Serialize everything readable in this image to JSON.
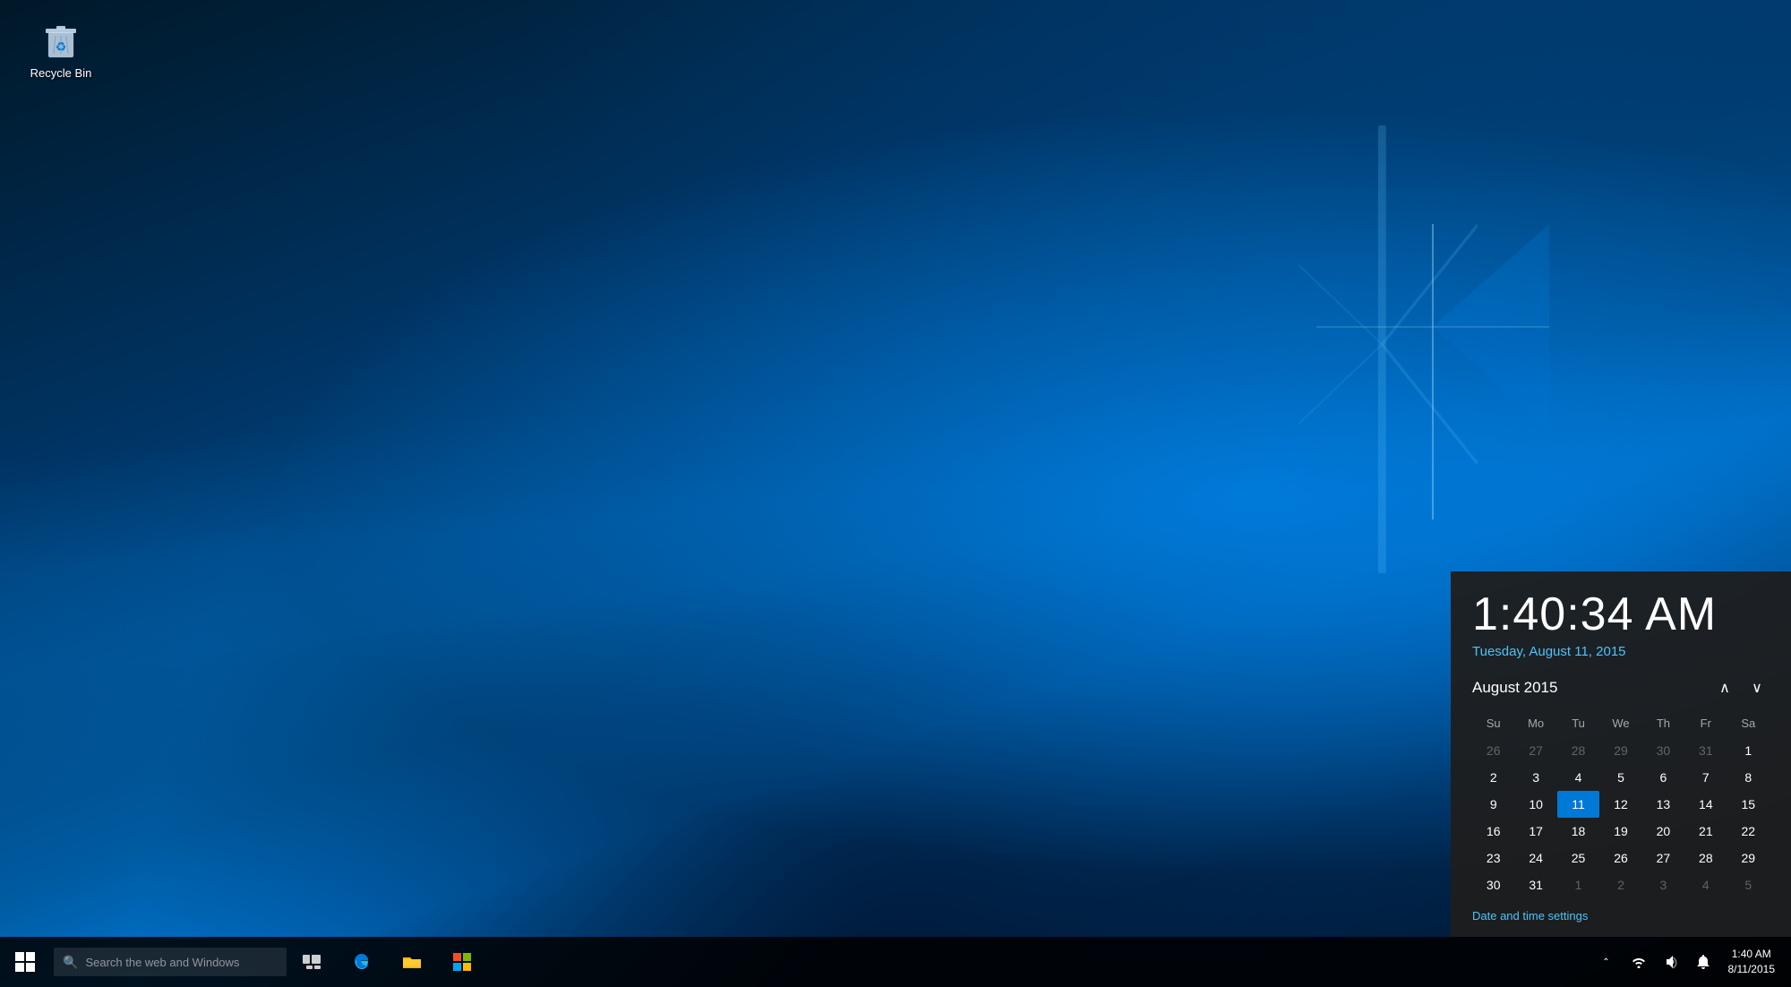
{
  "desktop": {
    "recycle_bin_label": "Recycle Bin"
  },
  "taskbar": {
    "search_placeholder": "Search the web and Windows",
    "clock": {
      "time": "1:40 AM",
      "date": "8/11/2015"
    }
  },
  "calendar_popup": {
    "time": "1:40:34 AM",
    "date_full": "Tuesday, August 11, 2015",
    "month_year": "August 2015",
    "nav_prev": "˄",
    "nav_next": "˅",
    "day_headers": [
      "Su",
      "Mo",
      "Tu",
      "We",
      "Th",
      "Fr",
      "Sa"
    ],
    "weeks": [
      [
        {
          "day": "26",
          "type": "other-month"
        },
        {
          "day": "27",
          "type": "other-month"
        },
        {
          "day": "28",
          "type": "other-month"
        },
        {
          "day": "29",
          "type": "other-month"
        },
        {
          "day": "30",
          "type": "other-month"
        },
        {
          "day": "31",
          "type": "other-month"
        },
        {
          "day": "1",
          "type": "normal"
        }
      ],
      [
        {
          "day": "2",
          "type": "normal"
        },
        {
          "day": "3",
          "type": "normal"
        },
        {
          "day": "4",
          "type": "normal"
        },
        {
          "day": "5",
          "type": "normal"
        },
        {
          "day": "6",
          "type": "normal"
        },
        {
          "day": "7",
          "type": "normal"
        },
        {
          "day": "8",
          "type": "normal"
        }
      ],
      [
        {
          "day": "9",
          "type": "normal"
        },
        {
          "day": "10",
          "type": "normal"
        },
        {
          "day": "11",
          "type": "today"
        },
        {
          "day": "12",
          "type": "normal"
        },
        {
          "day": "13",
          "type": "normal"
        },
        {
          "day": "14",
          "type": "normal"
        },
        {
          "day": "15",
          "type": "normal"
        }
      ],
      [
        {
          "day": "16",
          "type": "normal"
        },
        {
          "day": "17",
          "type": "normal"
        },
        {
          "day": "18",
          "type": "normal"
        },
        {
          "day": "19",
          "type": "normal"
        },
        {
          "day": "20",
          "type": "normal"
        },
        {
          "day": "21",
          "type": "normal"
        },
        {
          "day": "22",
          "type": "normal"
        }
      ],
      [
        {
          "day": "23",
          "type": "normal"
        },
        {
          "day": "24",
          "type": "normal"
        },
        {
          "day": "25",
          "type": "normal"
        },
        {
          "day": "26",
          "type": "normal"
        },
        {
          "day": "27",
          "type": "normal"
        },
        {
          "day": "28",
          "type": "normal"
        },
        {
          "day": "29",
          "type": "normal"
        }
      ],
      [
        {
          "day": "30",
          "type": "normal"
        },
        {
          "day": "31",
          "type": "normal"
        },
        {
          "day": "1",
          "type": "other-month"
        },
        {
          "day": "2",
          "type": "other-month"
        },
        {
          "day": "3",
          "type": "other-month"
        },
        {
          "day": "4",
          "type": "other-month"
        },
        {
          "day": "5",
          "type": "other-month"
        }
      ]
    ],
    "settings_link": "Date and time settings"
  }
}
